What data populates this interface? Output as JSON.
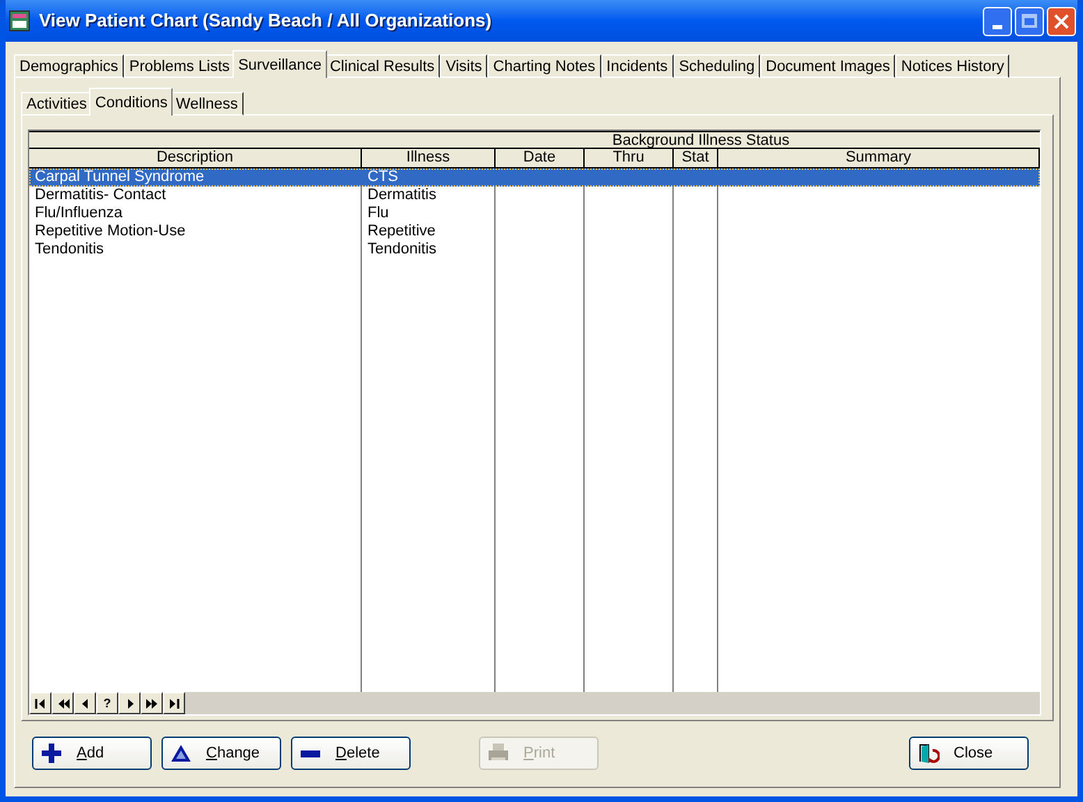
{
  "window": {
    "title": "View Patient Chart (Sandy Beach / All Organizations)"
  },
  "tabs": [
    {
      "label": "Demographics",
      "selected": false
    },
    {
      "label": "Problems Lists",
      "selected": false
    },
    {
      "label": "Surveillance",
      "selected": true
    },
    {
      "label": "Clinical Results",
      "selected": false
    },
    {
      "label": "Visits",
      "selected": false
    },
    {
      "label": "Charting Notes",
      "selected": false
    },
    {
      "label": "Incidents",
      "selected": false
    },
    {
      "label": "Scheduling",
      "selected": false
    },
    {
      "label": "Document Images",
      "selected": false
    },
    {
      "label": "Notices History",
      "selected": false
    }
  ],
  "subtabs": [
    {
      "label": "Activities",
      "selected": false
    },
    {
      "label": "Conditions",
      "selected": true
    },
    {
      "label": "Wellness",
      "selected": false
    }
  ],
  "table": {
    "group_header": "Background Illness Status",
    "columns": [
      "Description",
      "Illness",
      "Date",
      "Thru",
      "Stat",
      "Summary"
    ],
    "rows": [
      {
        "cells": [
          "Carpal Tunnel Syndrome",
          "CTS",
          "",
          "",
          "",
          ""
        ],
        "selected": true
      },
      {
        "cells": [
          "Dermatitis- Contact",
          "Dermatitis",
          "",
          "",
          "",
          ""
        ],
        "selected": false
      },
      {
        "cells": [
          "Flu/Influenza",
          "Flu",
          "",
          "",
          "",
          ""
        ],
        "selected": false
      },
      {
        "cells": [
          "Repetitive Motion-Use",
          "Repetitive",
          "",
          "",
          "",
          ""
        ],
        "selected": false
      },
      {
        "cells": [
          "Tendonitis",
          "Tendonitis",
          "",
          "",
          "",
          ""
        ],
        "selected": false
      }
    ]
  },
  "navigator": [
    {
      "kind": "first"
    },
    {
      "kind": "prior-page"
    },
    {
      "kind": "prior"
    },
    {
      "kind": "query",
      "label": "?"
    },
    {
      "kind": "next"
    },
    {
      "kind": "next-page"
    },
    {
      "kind": "last"
    }
  ],
  "buttons": [
    {
      "kind": "add",
      "label": "Add",
      "first_letter_underlined": true,
      "disabled": false
    },
    {
      "kind": "change",
      "label": "Change",
      "first_letter_underlined": true,
      "disabled": false
    },
    {
      "kind": "delete",
      "label": "Delete",
      "first_letter_underlined": true,
      "disabled": false
    },
    {
      "kind": "print",
      "label": "Print",
      "first_letter_underlined": true,
      "disabled": true
    },
    {
      "kind": "close",
      "label": "Close",
      "disabled": false
    }
  ]
}
